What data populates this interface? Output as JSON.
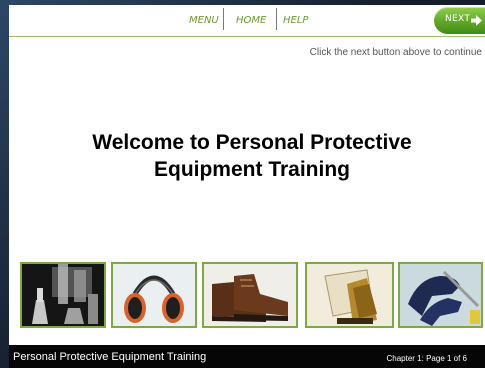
{
  "nav": {
    "menu_label": "MENU",
    "home_label": "HOME",
    "help_label": "HELP",
    "next_label": "NEXT"
  },
  "instruction_text": "Click the next button above to continue",
  "welcome": {
    "line1": "Welcome to Personal Protective",
    "line2": "Equipment Training"
  },
  "thumbnails": [
    {
      "icon": "lab-glassware-chemical-hazard-image"
    },
    {
      "icon": "hearing-protection-earmuffs-image"
    },
    {
      "icon": "safety-work-boots-image"
    },
    {
      "icon": "welding-face-shield-image"
    },
    {
      "icon": "protective-gloves-image"
    }
  ],
  "footer": {
    "course_title": "Personal Protective Equipment Training",
    "page_indicator": "Chapter 1: Page 1 of 6"
  },
  "colors": {
    "accent_green": "#6e9a2c",
    "next_button_green": "#5fa826",
    "thumbnail_border": "#7fa83e",
    "footer_background": "#060606"
  }
}
